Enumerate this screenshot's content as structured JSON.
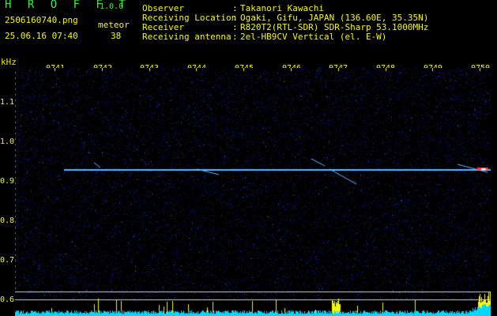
{
  "header": {
    "title": "H R O F F T",
    "version": "1.0.0",
    "filename": "2506160740.png",
    "datetime": "25.06.16 07:40",
    "meteor_label": "meteor",
    "meteor_count": "38",
    "info": [
      {
        "label": "Observer",
        "value": "Takanori Kawachi"
      },
      {
        "label": "Receiving Location",
        "value": "Ogaki, Gifu, JAPAN (136.60E, 35.35N)"
      },
      {
        "label": "Receiver",
        "value": "R820T2(RTL-SDR) SDR-Sharp 53.1000MHz"
      },
      {
        "label": "Receiving antenna",
        "value": "2el-HB9CV Vertical (el. E-W)"
      }
    ]
  },
  "axes": {
    "y_unit": "kHz",
    "y_ticks": [
      "1.1",
      "1.0",
      "0.9",
      "0.8",
      "0.7",
      "0.6"
    ],
    "x_ticks": [
      "0741",
      "0742",
      "0743",
      "0744",
      "0745",
      "0746",
      "0747",
      "0748",
      "0749",
      "0750"
    ]
  },
  "colors": {
    "background": "#000000",
    "text": "#f7f700",
    "title": "#3cf03c",
    "noise": "#1a1a80",
    "carrier": "#3aa0ff",
    "baseline": "#00d8ff"
  }
}
